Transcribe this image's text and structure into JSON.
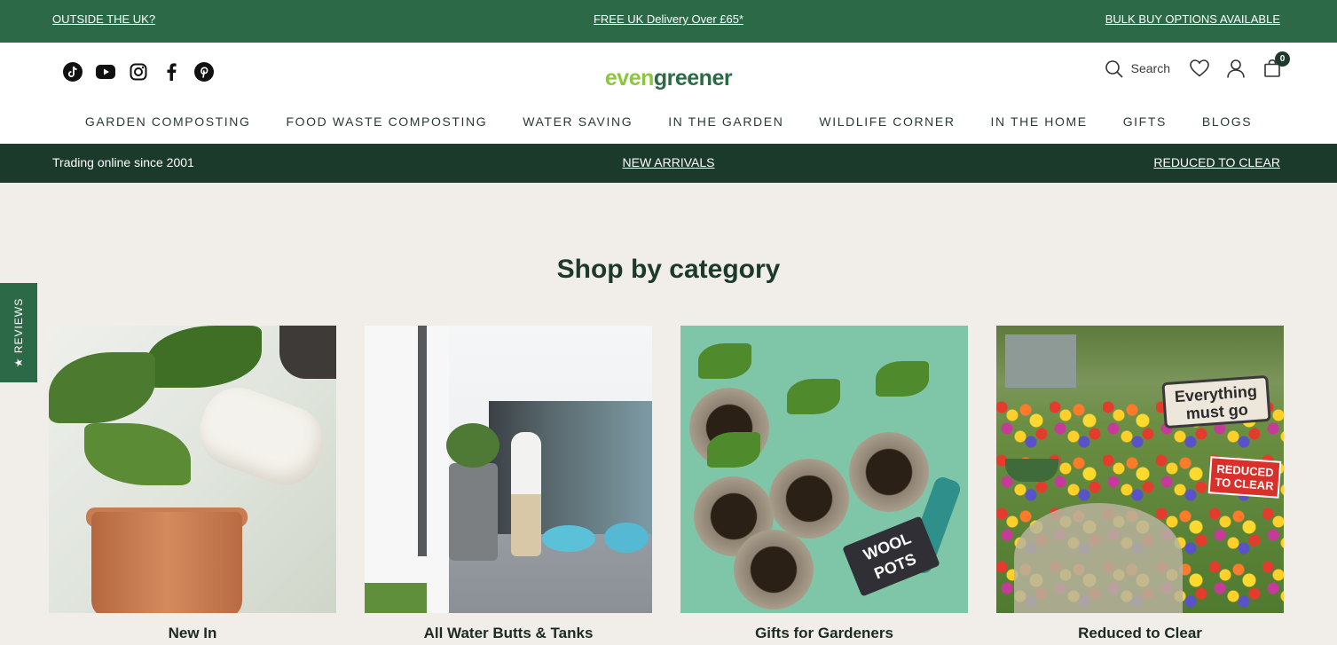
{
  "top_bar": {
    "left_link": "OUTSIDE THE UK?",
    "center_link": "FREE UK Delivery Over £65*",
    "right_link": "BULK BUY OPTIONS AVAILABLE"
  },
  "social_icons": [
    "tiktok-icon",
    "youtube-icon",
    "instagram-icon",
    "facebook-icon",
    "pinterest-icon"
  ],
  "logo": {
    "part1": "even",
    "part2": "greener"
  },
  "header_tools": {
    "search_label": "Search",
    "cart_count": "0",
    "icons": [
      "search-icon",
      "heart-icon",
      "account-icon",
      "cart-icon"
    ]
  },
  "nav": {
    "items": [
      "GARDEN COMPOSTING",
      "FOOD WASTE COMPOSTING",
      "WATER SAVING",
      "IN THE GARDEN",
      "WILDLIFE CORNER",
      "IN THE HOME",
      "GIFTS",
      "BLOGS"
    ]
  },
  "sub_bar": {
    "left_text": "Trading online since 2001",
    "center_link": "NEW ARRIVALS",
    "right_link": "REDUCED TO CLEAR"
  },
  "reviews_tab": "★ REVIEWS",
  "section": {
    "title": "Shop by category",
    "cards": [
      {
        "label": "New In"
      },
      {
        "label": "All Water Butts & Tanks",
        "image_text": ""
      },
      {
        "label": "Gifts for Gardeners",
        "image_text": "WOOL POTS"
      },
      {
        "label": "Reduced to Clear",
        "image_sign1": "Everything must go",
        "image_sign2": "REDUCED TO CLEAR"
      }
    ]
  },
  "colors": {
    "top_bar": "#2c6a47",
    "sub_bar": "#1b3a2b",
    "page_bg": "#f1eee9",
    "logo_green_light": "#8cc63f",
    "logo_green_dark": "#2c6a47"
  }
}
